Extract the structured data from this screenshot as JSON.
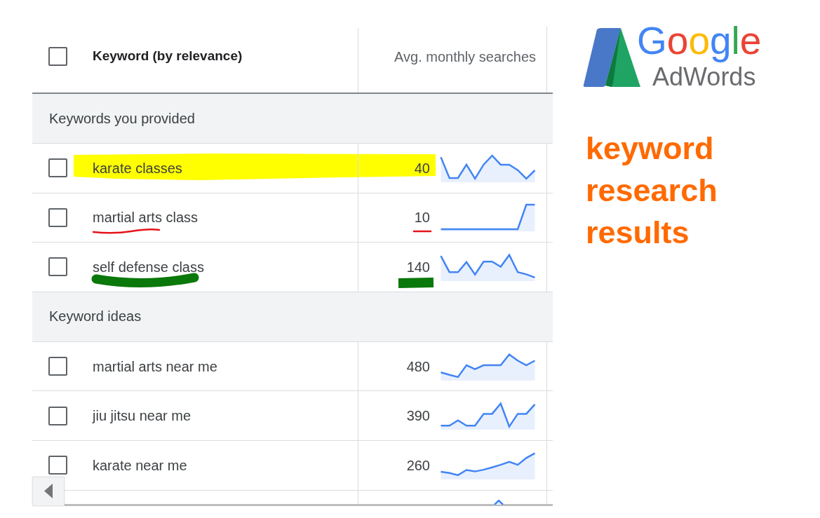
{
  "table": {
    "header": {
      "select_all": {
        "checked": false
      },
      "keyword_column": "Keyword (by relevance)",
      "searches_column": "Avg. monthly searches"
    },
    "groups": [
      {
        "label": "Keywords you provided",
        "rows": [
          {
            "keyword": "karate classes",
            "searches": "40",
            "checked": false,
            "annotation": {
              "kind": "highlight",
              "color": "#ffff00"
            }
          },
          {
            "keyword": "martial arts class",
            "searches": "10",
            "checked": false,
            "annotation": {
              "kind": "underline",
              "color": "#e5131a"
            }
          },
          {
            "keyword": "self defense class",
            "searches": "140",
            "checked": false,
            "annotation": {
              "kind": "marker",
              "color": "#0a780a"
            }
          }
        ]
      },
      {
        "label": "Keyword ideas",
        "rows": [
          {
            "keyword": "martial arts near me",
            "searches": "480",
            "checked": false
          },
          {
            "keyword": "jiu jitsu near me",
            "searches": "390",
            "checked": false
          },
          {
            "keyword": "karate near me",
            "searches": "260",
            "checked": false
          }
        ]
      }
    ]
  },
  "logo": {
    "wordmark": "Google",
    "product": "AdWords"
  },
  "caption": "keyword research results"
}
